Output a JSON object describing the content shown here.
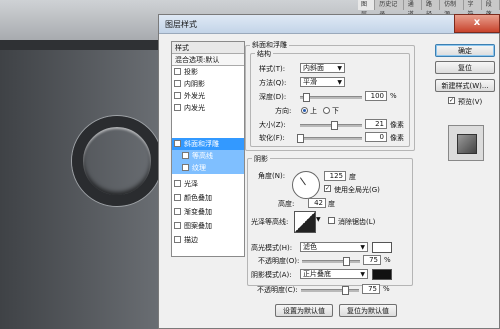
{
  "panel_tabs": [
    "图层",
    "历史记录",
    "通道",
    "路径",
    "仿制源",
    "字符",
    "段落"
  ],
  "dialog": {
    "title": "图层样式",
    "close_label": "x",
    "style_list": {
      "header": "样式",
      "items": [
        {
          "label": "混合选项:默认",
          "type": "head"
        },
        {
          "label": "投影",
          "checked": false
        },
        {
          "label": "内阴影",
          "checked": false
        },
        {
          "label": "外发光",
          "checked": false
        },
        {
          "label": "内发光",
          "checked": false
        },
        {
          "label": "斜面和浮雕",
          "checked": true,
          "selected": true
        },
        {
          "label": "等高线",
          "checked": false,
          "sub": true
        },
        {
          "label": "纹理",
          "checked": false,
          "sub": true
        },
        {
          "label": "光泽",
          "checked": false
        },
        {
          "label": "颜色叠加",
          "checked": false
        },
        {
          "label": "渐变叠加",
          "checked": false
        },
        {
          "label": "图案叠加",
          "checked": false
        },
        {
          "label": "描边",
          "checked": false
        }
      ]
    },
    "buttons": {
      "ok": "确定",
      "reset": "复位",
      "new_style": "新建样式(W)...",
      "preview": "预览(V)"
    },
    "bevel": {
      "group_title": "斜面和浮雕",
      "struct_title": "结构",
      "style_label": "样式(T):",
      "style_value": "内斜面",
      "technique_label": "方法(Q):",
      "technique_value": "平滑",
      "depth_label": "深度(D):",
      "depth_value": "100",
      "depth_unit": "%",
      "depth_fraction": 0.1,
      "direction_label": "方向:",
      "dir_up": "上",
      "dir_down": "下",
      "size_label": "大小(Z):",
      "size_value": "21",
      "size_unit": "像素",
      "size_fraction": 0.55,
      "soften_label": "软化(F):",
      "soften_value": "0",
      "soften_unit": "像素",
      "soften_fraction": 0.0
    },
    "shading": {
      "title": "阴影",
      "angle_label": "角度(N):",
      "angle_value": "125",
      "angle_unit": "度",
      "global_light_label": "使用全局光(G)",
      "altitude_label": "高度:",
      "altitude_value": "42",
      "altitude_unit": "度",
      "gloss_label": "光泽等高线:",
      "antialias_label": "消除锯齿(L)",
      "highlight_label": "高光模式(H):",
      "highlight_value": "滤色",
      "highlight_color": "#ffffff",
      "hl_opacity_label": "不透明度(O):",
      "hl_opacity_value": "75",
      "hl_opacity_unit": "%",
      "hl_opacity_fraction": 0.75,
      "shadow_label": "阴影模式(A):",
      "shadow_value": "正片叠底",
      "shadow_color": "#111111",
      "sh_opacity_label": "不透明度(C):",
      "sh_opacity_value": "75",
      "sh_opacity_unit": "%",
      "sh_opacity_fraction": 0.75
    },
    "bottom": {
      "set_default": "设置为默认值",
      "reset_default": "复位为默认值"
    }
  }
}
